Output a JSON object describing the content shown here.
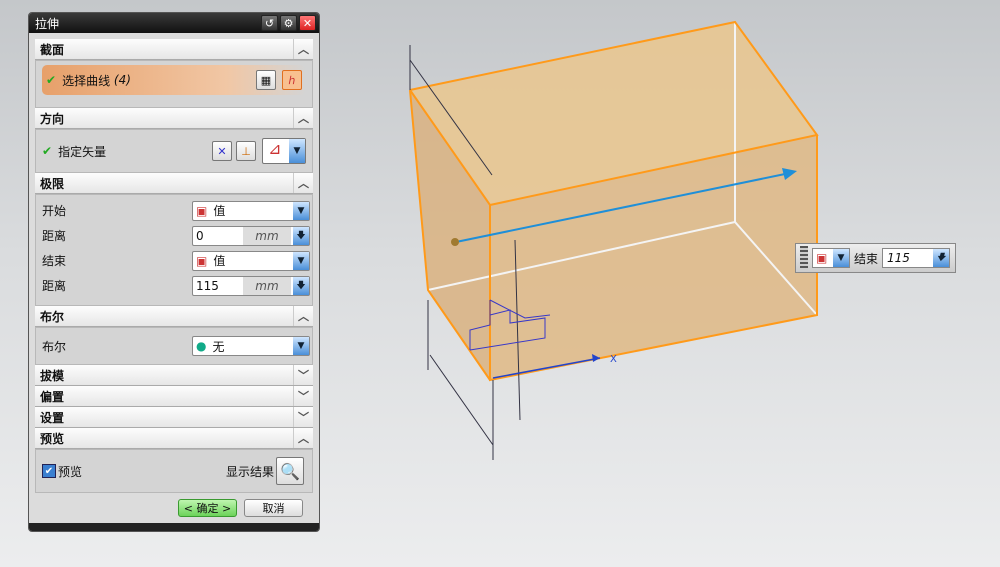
{
  "dialog": {
    "title": "拉伸",
    "sections": {
      "section": {
        "label": "截面",
        "select_curve": "选择曲线",
        "count": "(4)"
      },
      "direction": {
        "label": "方向",
        "specify_vector": "指定矢量"
      },
      "limits": {
        "label": "极限",
        "start_label": "开始",
        "start_value": "值",
        "start_distance_label": "距离",
        "start_distance": "0",
        "end_label": "结束",
        "end_value": "值",
        "end_distance_label": "距离",
        "end_distance": "115",
        "unit": "mm"
      },
      "boolean": {
        "label": "布尔",
        "field_label": "布尔",
        "value": "无"
      },
      "draft": {
        "label": "拔模"
      },
      "offset": {
        "label": "偏置"
      },
      "settings": {
        "label": "设置"
      },
      "preview": {
        "label": "预览",
        "checkbox_label": "预览",
        "checked": true,
        "show_result": "显示结果"
      }
    },
    "ok": "< 确定 >",
    "cancel": "取消"
  },
  "floating": {
    "label": "结束",
    "value": "115"
  },
  "viewport": {
    "axis_label": "X",
    "colors": {
      "edge": "#ff9a1a",
      "vector": "#1f8fd8",
      "face": "#e7c08a"
    }
  }
}
